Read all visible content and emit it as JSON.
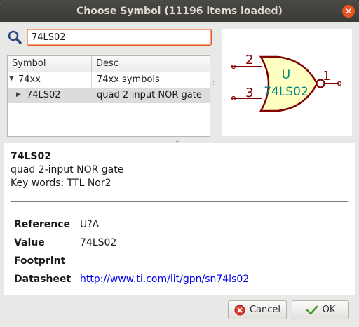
{
  "window": {
    "title": "Choose Symbol (11196 items loaded)"
  },
  "search": {
    "value": "74LS02"
  },
  "tree": {
    "columns": [
      "Symbol",
      "Desc"
    ],
    "rows": [
      {
        "symbol": "74xx",
        "desc": "74xx symbols",
        "expanded": true
      },
      {
        "symbol": "74LS02",
        "desc": "quad 2-input NOR gate",
        "selected": true
      }
    ]
  },
  "preview": {
    "ref": "U",
    "value": "74LS02",
    "pins": [
      "2",
      "3",
      "1"
    ],
    "colors": {
      "pin": "#840000",
      "body": "#840000",
      "fill": "#ffffc2",
      "text": "#008484"
    }
  },
  "details": {
    "name": "74LS02",
    "description": "quad 2-input NOR gate",
    "keywords": "Key words: TTL Nor2",
    "fields": [
      {
        "label": "Reference",
        "value": "U?A"
      },
      {
        "label": "Value",
        "value": "74LS02"
      },
      {
        "label": "Footprint",
        "value": ""
      },
      {
        "label": "Datasheet",
        "value": "http://www.ti.com/lit/gpn/sn74ls02"
      }
    ]
  },
  "buttons": {
    "cancel": "Cancel",
    "ok": "OK"
  }
}
